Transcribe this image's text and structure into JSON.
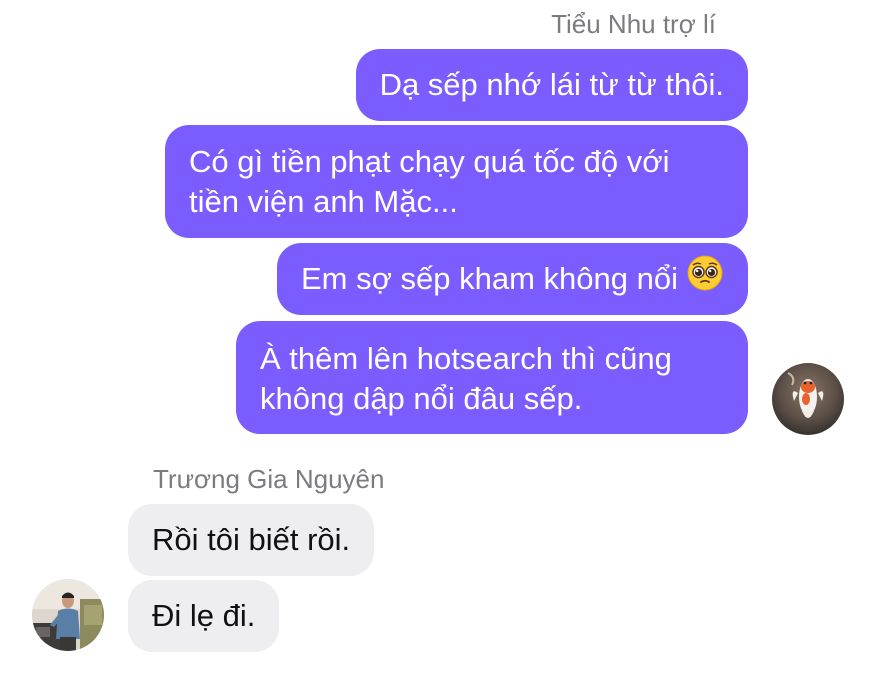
{
  "outgoing": {
    "sender_name": "Tiểu Nhu trợ lí",
    "messages": [
      {
        "lines": [
          "Dạ sếp nhớ lái từ từ thôi."
        ]
      },
      {
        "lines": [
          "Có gì tiền phạt chạy quá tốc độ với",
          "tiền viện anh Mặc..."
        ]
      },
      {
        "lines": [
          "Em sợ sếp kham không nổi"
        ],
        "emoji": "pleading-face-icon"
      },
      {
        "lines": [
          "À thêm lên hotsearch thì cũng",
          "không dập nổi đâu sếp."
        ]
      }
    ],
    "avatar": "koi-fish-avatar"
  },
  "incoming": {
    "sender_name": "Trương Gia Nguyên",
    "messages": [
      {
        "lines": [
          "Rồi tôi biết rồi."
        ]
      },
      {
        "lines": [
          "Đi lẹ đi."
        ]
      }
    ],
    "avatar": "man-photo-avatar"
  },
  "colors": {
    "outgoing_bubble": "#7b5cff",
    "incoming_bubble": "#eeeef1",
    "name_text": "#7b7b80"
  }
}
